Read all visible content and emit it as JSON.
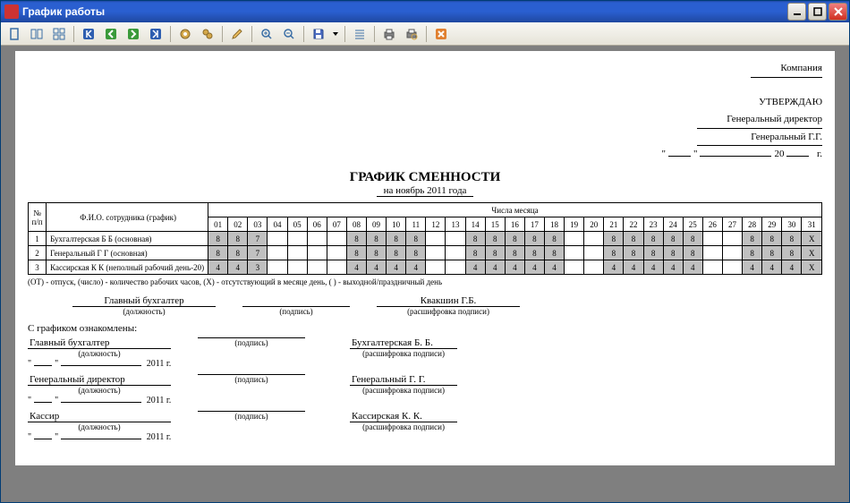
{
  "window": {
    "title": "График работы"
  },
  "header": {
    "company": "Компания",
    "approve": "УТВЕРЖДАЮ",
    "position": "Генеральный директор",
    "name": "Генеральный Г.Г.",
    "year_suffix": "20",
    "year_end": "г."
  },
  "doc": {
    "title": "ГРАФИК СМЕННОСТИ",
    "subtitle": "на ноябрь 2011 года"
  },
  "table": {
    "col_num": "№ п/п",
    "col_name": "Ф.И.О. сотрудника\n(график)",
    "col_days": "Числа месяца",
    "days": [
      "01",
      "02",
      "03",
      "04",
      "05",
      "06",
      "07",
      "08",
      "09",
      "10",
      "11",
      "12",
      "13",
      "14",
      "15",
      "16",
      "17",
      "18",
      "19",
      "20",
      "21",
      "22",
      "23",
      "24",
      "25",
      "26",
      "27",
      "28",
      "29",
      "30",
      "31"
    ],
    "rows": [
      {
        "n": "1",
        "name": "Бухгалтерская Б Б (основная)",
        "vals": [
          "8",
          "8",
          "7",
          "",
          "",
          "",
          "",
          "8",
          "8",
          "8",
          "8",
          "",
          "",
          "8",
          "8",
          "8",
          "8",
          "8",
          "",
          "",
          "8",
          "8",
          "8",
          "8",
          "8",
          "",
          "",
          "8",
          "8",
          "8",
          "X"
        ]
      },
      {
        "n": "2",
        "name": "Генеральный Г Г (основная)",
        "vals": [
          "8",
          "8",
          "7",
          "",
          "",
          "",
          "",
          "8",
          "8",
          "8",
          "8",
          "",
          "",
          "8",
          "8",
          "8",
          "8",
          "8",
          "",
          "",
          "8",
          "8",
          "8",
          "8",
          "8",
          "",
          "",
          "8",
          "8",
          "8",
          "X"
        ]
      },
      {
        "n": "3",
        "name": "Кассирская К К (неполный рабочий день-20)",
        "vals": [
          "4",
          "4",
          "3",
          "",
          "",
          "",
          "",
          "4",
          "4",
          "4",
          "4",
          "",
          "",
          "4",
          "4",
          "4",
          "4",
          "4",
          "",
          "",
          "4",
          "4",
          "4",
          "4",
          "4",
          "",
          "",
          "4",
          "4",
          "4",
          "X"
        ]
      }
    ],
    "shaded_days": [
      1,
      2,
      3,
      8,
      9,
      10,
      11,
      14,
      15,
      16,
      17,
      18,
      21,
      22,
      23,
      24,
      25,
      28,
      29,
      30,
      31
    ]
  },
  "legend": "(ОТ) - отпуск, (число) - количество рабочих часов, (Х) - отсутствующий в месяце день, ( ) - выходной/праздничный день",
  "sig": {
    "pos_label": "(должность)",
    "sign_label": "(подпись)",
    "decode_label": "(расшифровка подписи)",
    "chief_acc": "Главный бухгалтер",
    "chief_acc_name": "Квакшин Г.Б.",
    "ack_title": "С графиком ознакомлены:",
    "year": "2011 г.",
    "people": [
      {
        "pos": "Главный бухгалтер",
        "name": "Бухгалтерская Б. Б."
      },
      {
        "pos": "Генеральный директор",
        "name": "Генеральный Г. Г."
      },
      {
        "pos": "Кассир",
        "name": "Кассирская К. К."
      }
    ]
  }
}
